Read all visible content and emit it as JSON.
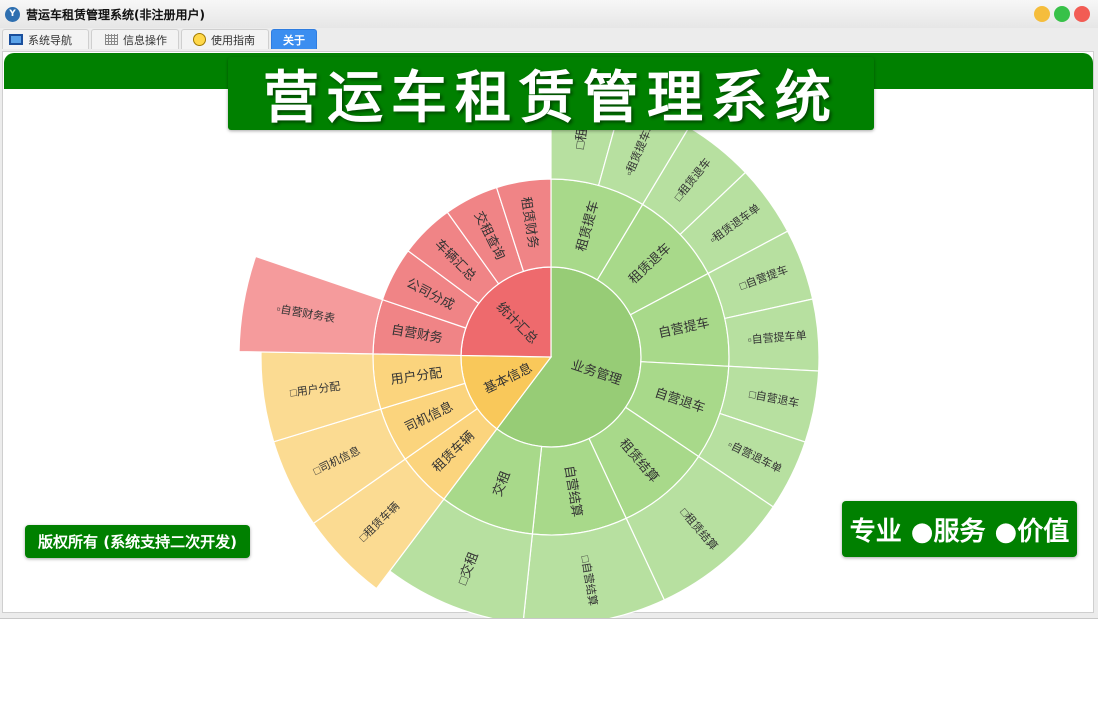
{
  "window": {
    "title": "营运车租赁管理系统(非注册用户)",
    "app_icon": "Y"
  },
  "tabs": [
    {
      "label": "系统导航",
      "icon": "monitor-icon"
    },
    {
      "label": "信息操作",
      "icon": "grid-icon"
    },
    {
      "label": "使用指南",
      "icon": "bulb-icon"
    },
    {
      "label": "关于",
      "active": true
    }
  ],
  "header": {
    "title": "营运车租赁管理系统"
  },
  "footer": {
    "copyright": "版权所有 (系统支持二次开发)",
    "slogan": "专业 ●服务 ●价值"
  },
  "colors": {
    "brand_green": "#008000",
    "business": [
      "#97cc76",
      "#a8d98a",
      "#b7e0a0"
    ],
    "stats": [
      "#ee6a6d",
      "#f08486",
      "#f59b9c"
    ],
    "basic": [
      "#f9c85a",
      "#fbd47d",
      "#fbdb92"
    ]
  },
  "sunburst": [
    {
      "name": "业务管理",
      "group": "business",
      "children": [
        {
          "name": "租赁提车",
          "children": [
            {
              "name": "□租赁"
            },
            {
              "name": "▫租赁提车单"
            }
          ]
        },
        {
          "name": "租赁退车",
          "children": [
            {
              "name": "□租赁退车"
            },
            {
              "name": "▫租赁退车单"
            }
          ]
        },
        {
          "name": "自营提车",
          "children": [
            {
              "name": "□自营提车"
            },
            {
              "name": "▫自营提车单"
            }
          ]
        },
        {
          "name": "自营退车",
          "children": [
            {
              "name": "□自营退车"
            },
            {
              "name": "▫自营退车单"
            }
          ]
        },
        {
          "name": "租赁结算",
          "children": [
            {
              "name": "□租赁结算"
            }
          ]
        },
        {
          "name": "自营结算",
          "children": [
            {
              "name": "□自营结算"
            }
          ]
        },
        {
          "name": "交租",
          "children": [
            {
              "name": "□交租"
            }
          ]
        }
      ]
    },
    {
      "name": "基本信息",
      "group": "basic",
      "children": [
        {
          "name": "租赁车辆",
          "children": [
            {
              "name": "□租赁车辆"
            }
          ]
        },
        {
          "name": "司机信息",
          "children": [
            {
              "name": "□司机信息"
            }
          ]
        },
        {
          "name": "用户分配",
          "children": [
            {
              "name": "□用户分配"
            }
          ]
        }
      ]
    },
    {
      "name": "统计汇总",
      "group": "stats",
      "children": [
        {
          "name": "自营财务",
          "children": [
            {
              "name": "▫自营财务表"
            }
          ]
        },
        {
          "name": "公司分成"
        },
        {
          "name": "车辆汇总"
        },
        {
          "name": "交租查询"
        },
        {
          "name": "租赁财务"
        }
      ]
    }
  ]
}
